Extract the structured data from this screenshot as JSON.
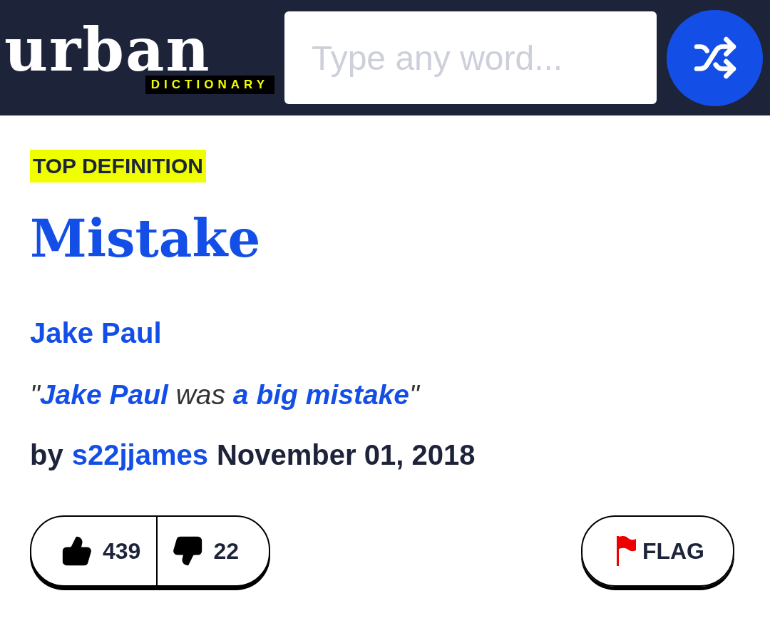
{
  "header": {
    "logo": {
      "word": "urban",
      "tagline": "DICTIONARY"
    },
    "search": {
      "placeholder": "Type any word..."
    }
  },
  "definition": {
    "badge": "TOP DEFINITION",
    "word": "Mistake",
    "meaning": "Jake Paul",
    "example": "\"**Jake Paul** was **a big mistake**\"",
    "by": "by",
    "author": "s22jjames",
    "date": "November 01, 2018",
    "votes": {
      "up": "439",
      "down": "22"
    },
    "flag": "FLAG"
  }
}
